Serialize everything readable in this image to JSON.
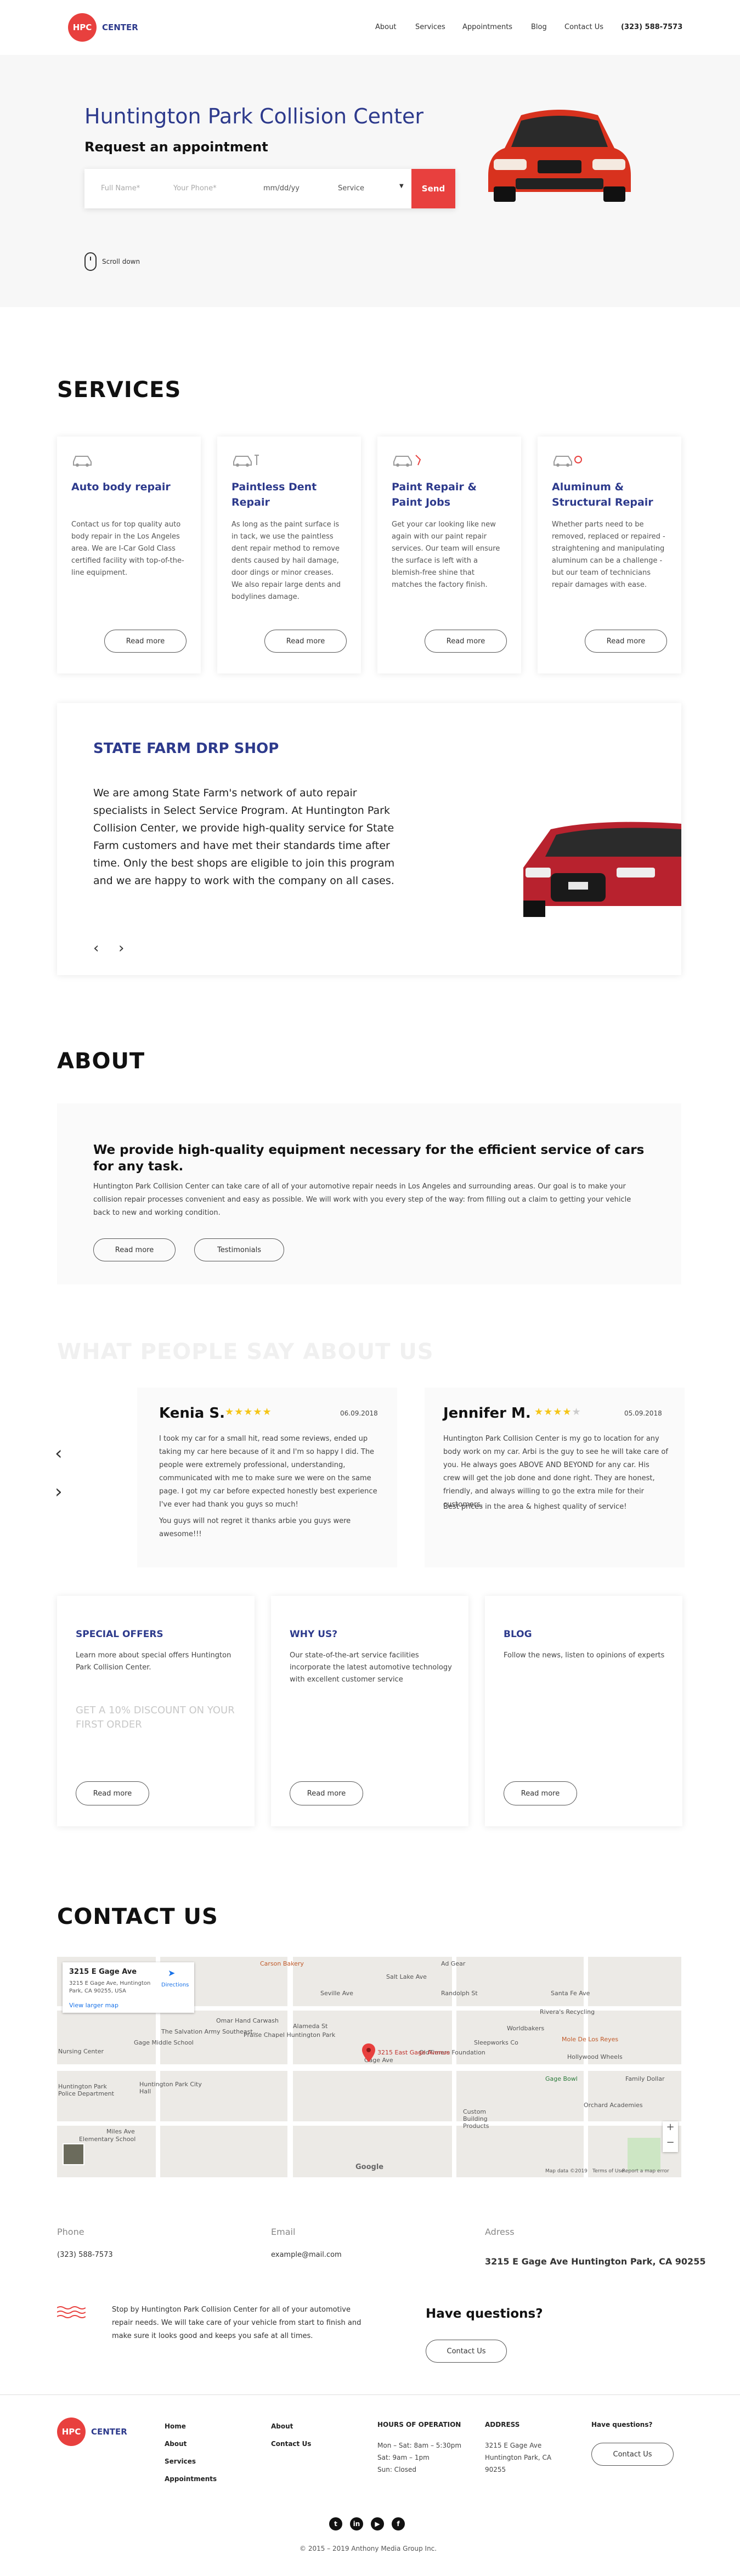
{
  "header": {
    "logo_mark": "HPC",
    "logo_text": "CENTER",
    "nav": [
      "About",
      "Services",
      "Appointments",
      "Blog",
      "Contact Us"
    ],
    "phone": "(323) 588-7573"
  },
  "hero": {
    "title": "Huntington Park Collision Center",
    "subtitle": "Request an appointment",
    "full_name_placeholder": "Full Name*",
    "phone_placeholder": "Your Phone*",
    "date_placeholder": "mm/dd/yy",
    "service_select": "Service",
    "send_label": "Send",
    "scroll_label": "Scroll down"
  },
  "services": {
    "title": "SERVICES",
    "cards": [
      {
        "title": "Auto body repair",
        "text": "Contact us for top quality auto body repair in the Los Angeles area. We are I-Car Gold Class certified facility with top-of-the-line equipment.",
        "button": "Read more"
      },
      {
        "title": "Paintless Dent Repair",
        "text": "As long as the paint surface is in tack, we use the paintless dent repair method to remove dents caused by hail damage, door dings or minor creases. We also repair large dents and bodylines damage.",
        "button": "Read more"
      },
      {
        "title": "Paint Repair & Paint Jobs",
        "text": "Get your car looking like new again with our paint repair services. Our team will ensure the surface is left with a blemish-free shine that matches the factory finish.",
        "button": "Read more"
      },
      {
        "title": "Aluminum & Structural Repair",
        "text": "Whether parts need to be removed, replaced or repaired - straightening and manipulating aluminum can be a challenge - but our team of technicians repair damages with ease.",
        "button": "Read more"
      }
    ]
  },
  "drp": {
    "title": "STATE FARM DRP SHOP",
    "text": "We are among State Farm's network of auto repair specialists in Select Service Program. At Huntington Park Collision Center, we provide high-quality service for State Farm customers and have met their standards time after time. Only the best shops are eligible to join this program and we are happy to work with the company on all cases."
  },
  "about": {
    "title": "ABOUT",
    "heading": "We provide high-quality equipment necessary for the efficient service of cars for any task.",
    "text": "Huntington Park Collision Center can take care of all of your automotive repair needs in Los Angeles and surrounding areas. Our goal is to make your collision repair processes convenient and easy as possible. We will work with you every step of the way: from filling out a claim to getting your vehicle back to new and working condition.",
    "btn_read": "Read more",
    "btn_testimonials": "Testimonials"
  },
  "testimonials": {
    "title": "WHAT PEOPLE SAY ABOUT US",
    "items": [
      {
        "name": "Kenia S.",
        "stars": "★★★★★",
        "rating": 5,
        "date": "06.09.2018",
        "p1": "I took my car for a small hit, read some reviews, ended up taking my car here because of it and I'm so happy I did. The people were extremely professional, understanding, communicated with me to make sure we were on the same page. I got my car before expected honestly best experience I've ever had thank you guys so much!",
        "p2": "You guys will not regret it thanks arbie you guys were awesome!!!"
      },
      {
        "name": "Jennifer M.",
        "stars": "★★★★★",
        "rating": 4,
        "date": "05.09.2018",
        "p1": "Huntington Park Collision Center is my go to location for any body work on my car. Arbi is the guy to see he will take care of you. He always goes ABOVE AND BEYOND for any car. His crew will get the job done and done right. They are honest, friendly, and always willing to go the extra mile for their customers.",
        "p2": "Best prices in the area & highest quality of service!"
      }
    ]
  },
  "offers": [
    {
      "title": "SPECIAL OFFERS",
      "text": "Learn more about special offers Huntington Park Collision Center.",
      "promo": "GET A 10% DISCOUNT ON YOUR FIRST ORDER",
      "button": "Read more"
    },
    {
      "title": "WHY US?",
      "text": "Our state-of-the-art service facilities incorporate the latest automotive technology with excellent customer service",
      "promo": "",
      "button": "Read more"
    },
    {
      "title": "BLOG",
      "text": "Follow the news, listen to opinions of experts",
      "promo": "",
      "button": "Read more"
    }
  ],
  "contact": {
    "title": "CONTACT US",
    "map_card_title": "3215 E Gage Ave",
    "map_card_address": "3215 E Gage Ave, Huntington Park, CA 90255, USA",
    "map_card_link": "View larger map",
    "map_directions": "Directions",
    "map_pin_label": "3215 East Gage Avenue",
    "map_labels": [
      "Carson Bakery",
      "Ad Gear",
      "Randolph St",
      "Santa Fe Ave",
      "Rivera's Recycling",
      "Worldbakers",
      "Seville Ave",
      "Salt Lake Ave",
      "Alameda St",
      "The Salvation Army Southeast...",
      "Omar Hand Carwash",
      "Praise Chapel Huntington Park",
      "Sleepworks Co",
      "OldTimers Foundation",
      "Mole De Los Reyes",
      "Hollywood Wheels",
      "Gage Bowl",
      "Family Dollar",
      "Nursing Center",
      "Huntington Park Police Department",
      "Gage Middle School",
      "Huntington Park City Hall",
      "Orchard Academies",
      "Custom Building Products",
      "Miles Ave",
      "Elementary School",
      "Gage Ave",
      "Google",
      "Map data ©2019",
      "Terms of Use",
      "Report a map error"
    ],
    "phone_label": "Phone",
    "phone": "(323) 588-7573",
    "email_label": "Email",
    "email": "example@mail.com",
    "address_label": "Adress",
    "address": "3215 E Gage Ave Huntington Park, CA 90255",
    "blurb": "Stop by Huntington Park Collision Center for all of your automotive repair needs. We will take care of your vehicle from start to finish and make sure it looks good and keeps you safe at all times.",
    "question": "Have questions?",
    "contact_btn": "Contact Us"
  },
  "footer": {
    "col1": [
      "Home",
      "About",
      "Services",
      "Appointments"
    ],
    "col2": [
      "About",
      "Contact Us"
    ],
    "hours_title": "HOURS OF OPERATION",
    "hours": [
      "Mon – Sat: 8am – 5:30pm",
      "Sat: 9am – 1pm",
      "Sun: Closed"
    ],
    "address_title": "ADDRESS",
    "address": "3215 E Gage Ave Huntington Park, CA 90255",
    "question": "Have questions?",
    "contact_btn": "Contact Us",
    "social": [
      "twitter-icon",
      "linkedin-icon",
      "youtube-icon",
      "facebook-icon"
    ],
    "copyright": "© 2015 – 2019 Anthony Media Group Inc."
  },
  "colors": {
    "accent": "#e8403e",
    "brand": "#2d3a8c"
  }
}
